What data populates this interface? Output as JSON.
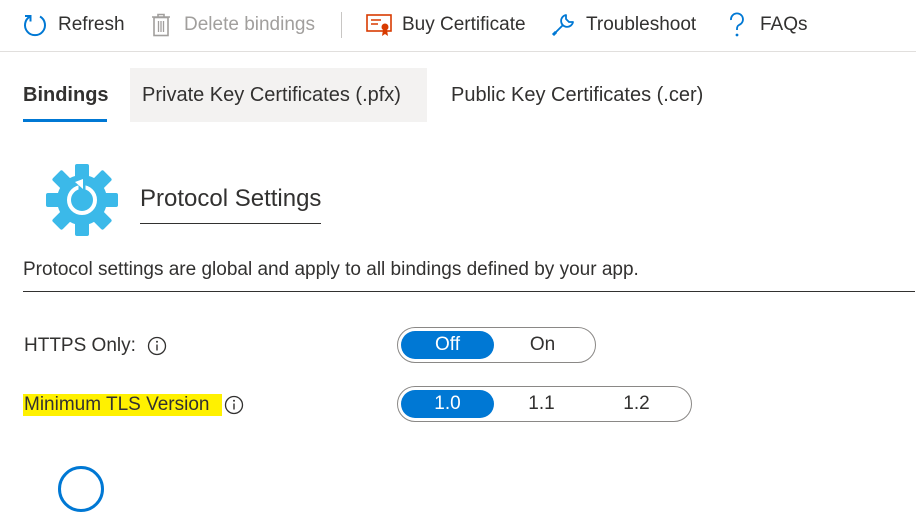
{
  "toolbar": {
    "refresh": "Refresh",
    "delete_bindings": "Delete bindings",
    "buy_certificate": "Buy Certificate",
    "troubleshoot": "Troubleshoot",
    "faqs": "FAQs"
  },
  "tabs": [
    {
      "label": "Bindings",
      "active": true
    },
    {
      "label": "Private Key Certificates (.pfx)",
      "active": false
    },
    {
      "label": "Public Key Certificates (.cer)",
      "active": false
    }
  ],
  "section": {
    "title": "Protocol Settings",
    "description": "Protocol settings are global and apply to all bindings defined by your app."
  },
  "settings": {
    "https_only": {
      "label": "HTTPS Only:",
      "options": [
        "Off",
        "On"
      ],
      "selected": "Off"
    },
    "min_tls": {
      "label": "Minimum TLS Version",
      "options": [
        "1.0",
        "1.1",
        "1.2"
      ],
      "selected": "1.0"
    }
  },
  "colors": {
    "accent": "#0078d4",
    "highlight": "#fff100",
    "gear": "#3bb9e9",
    "disabled": "#a19f9d"
  }
}
